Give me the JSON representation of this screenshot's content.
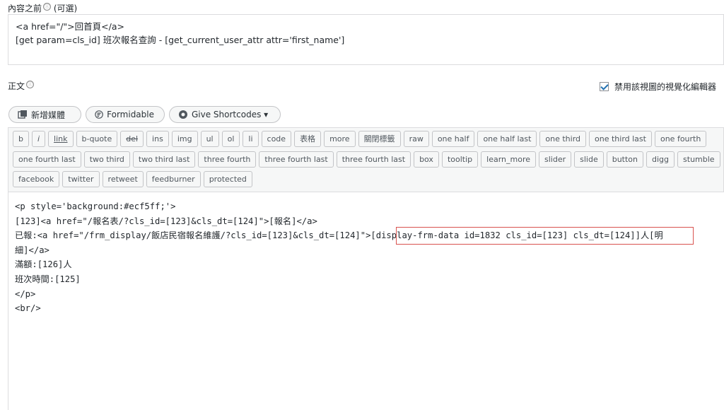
{
  "before_content": {
    "label": "內容之前",
    "info_icon": "ⓘ",
    "optional": "(可選)",
    "lines": [
      "<a href=\"/\">回首頁</a>",
      "[get param=cls_id] 班次報名查詢 - [get_current_user_attr attr='first_name']"
    ]
  },
  "body_label": "正文",
  "disable_visual_label": "禁用該視圖的視覺化編輯器",
  "media_buttons": [
    {
      "icon": "add-media-icon",
      "label": "新增媒體"
    },
    {
      "icon": "formidable-icon",
      "label": "Formidable"
    },
    {
      "icon": "shortcode-icon",
      "label": "Give Shortcodes ▾"
    }
  ],
  "quicktags": [
    [
      "b",
      "i",
      "link",
      "b-quote",
      "del",
      "ins",
      "img",
      "ul",
      "ol",
      "li",
      "code",
      "表格",
      "more",
      "關閉標籤",
      "raw",
      "one half",
      "one half last",
      "one third",
      "one third last",
      "one fourth"
    ],
    [
      "one fourth last",
      "two third",
      "two third last",
      "three fourth",
      "three fourth last",
      "three fourth last",
      "box",
      "tooltip",
      "learn_more",
      "slider",
      "slide",
      "button",
      "digg",
      "stumble"
    ],
    [
      "facebook",
      "twitter",
      "retweet",
      "feedburner",
      "protected"
    ]
  ],
  "editor_lines": [
    "<p style='background:#ecf5ff;'>",
    "[123]<a href=\"/報名表/?cls_id=[123]&cls_dt=[124]\">[報名]</a>",
    "已報:<a href=\"/frm_display/飯店民宿報名維護/?cls_id=[123]&cls_dt=[124]\">[display-frm-data id=1832 cls_id=[123] cls_dt=[124]]人[明",
    "細]</a>",
    "滿額:[126]人",
    "班次時間:[125]",
    "</p>",
    "<br/>"
  ],
  "colors": {
    "highlight": "#d9534f",
    "checkbox_check": "#2271b1"
  }
}
